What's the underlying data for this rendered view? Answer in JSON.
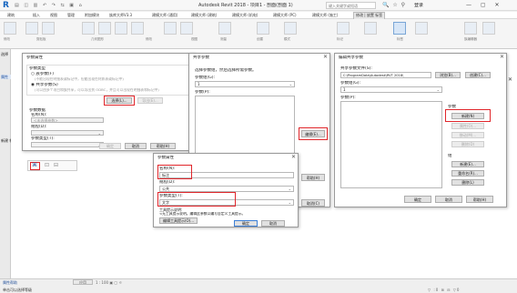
{
  "app": {
    "logo": "R",
    "title": "Autodesk Revit 2018 -  项目1 - 剖面(剖面 1)",
    "search_placeholder": "键入关键字或短语",
    "signin": "登录",
    "window_controls": "— ▢ ✕",
    "title_icons": "🔍  ☆  ⚲"
  },
  "ribbon_tabs": [
    "建筑",
    "插入",
    "视图",
    "管理",
    "附加模块",
    "族库大师V3.3",
    "建模大师 (通用)",
    "建模大师 (建筑)",
    "建模大师 (机电)",
    "建模大师 (PC)",
    "建模大师 (施工)",
    "修改 | 放置 标签"
  ],
  "ribbon_labels": [
    "修改",
    "选择",
    "属性",
    "剪贴板",
    "几何图形",
    "修改",
    "视图",
    "测量",
    "创建",
    "模式",
    "标记",
    "标签",
    "族编辑器"
  ],
  "left_panel": {
    "items": [
      "选择",
      "修改",
      "属性"
    ],
    "side_label": "新建 标签"
  },
  "dialog_param_props": {
    "title": "参数属性",
    "param_type_heading": "参数类型",
    "family_param_radio": "族参数(F)",
    "family_param_note": "(不能出现在明细表或标记中，但能出现在材质表或标记中)",
    "shared_param_radio": "共享参数(S)",
    "shared_param_note": "(可以由多个项目和族共享，可以导出到 ODBC，并且可以出现在明细表和标记中)",
    "select_button": "选择(L)...",
    "export_button": "导出(E)...",
    "param_data_heading": "参数数据",
    "name_label": "名称(N):",
    "name_value": "<未选择参数>",
    "discipline_label": "规程(D):",
    "param_type_label": "参数类型(T):",
    "ok_button": "确定",
    "cancel_button": "取消",
    "help_button": "帮助(H)"
  },
  "dialog_shared_params": {
    "title": "共享参数",
    "prompt": "选择参数组，然后选择所需参数。",
    "group_label": "参数组(G):",
    "group_value": "1",
    "params_label": "参数(P):",
    "edit_button": "编辑(E)..."
  },
  "dialog_edit_shared": {
    "title": "编辑共享参数",
    "file_label": "共享参数文件(S):",
    "file_path": "C:\\ProgramData\\Autodesk\\RVT 2018\\",
    "browse_button": "浏览(B)...",
    "create_button": "创建(C)...",
    "group_label": "参数组(G):",
    "group_value": "1",
    "params_label": "参数(P):",
    "params_heading": "参数",
    "new_button": "新建(N)",
    "props_button": "属性(O)...",
    "move_button": "移动(M)...",
    "delete_button": "删除(D)",
    "groups_heading": "组",
    "group_new_button": "新建(E)...",
    "rename_button": "重命名(R)...",
    "group_delete_button": "删除(L)",
    "ok_button": "确定",
    "cancel_button": "取消",
    "help_button": "帮助(H)"
  },
  "dialog_new_param": {
    "title": "参数属性",
    "name_label": "名称(N):",
    "name_value": "标注",
    "discipline_label": "规程(D):",
    "discipline_value": "公共",
    "param_type_label": "参数类型(T):",
    "param_type_value": "文字",
    "tooltip_label": "工具提示说明:",
    "tooltip_value": "<无工具提示说明。编辑此参数以编写自定义工具提示。",
    "edit_tooltip_button": "编辑工具提示(O)...",
    "ok_button": "确定",
    "cancel_button": "取消",
    "side_cancel": "取消(C)",
    "side_help": "帮助(H)"
  },
  "status": {
    "props_link": "属性帮助",
    "apply_button": "应用",
    "text": "单击可以选择等级",
    "mid": "1 : 100 ▣ ▢ ☼",
    "right": "▽ :0  ⊞ ⊟  ▽0"
  }
}
